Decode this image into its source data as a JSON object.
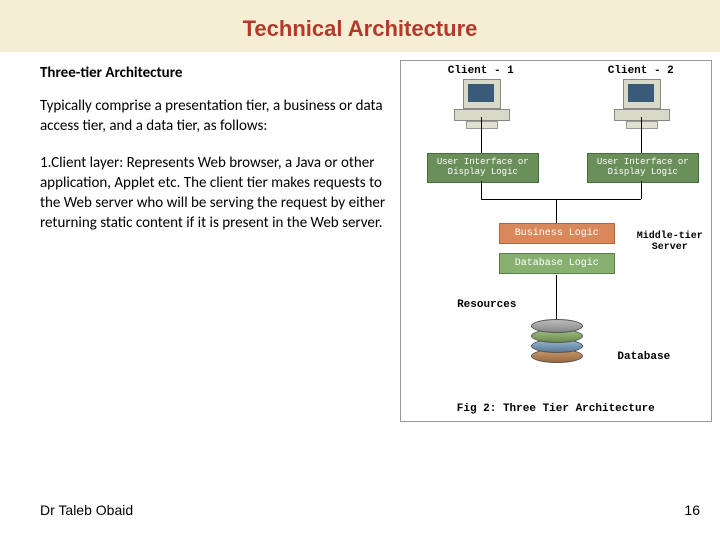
{
  "title": "Technical Architecture",
  "subheading": "Three-tier Architecture",
  "intro": "Typically comprise a presentation tier, a business or data access tier, and a data tier, as follows:",
  "point1": "1.Client layer: Represents Web browser, a Java or other application, Applet etc. The client tier makes requests to the Web server who will be serving the request by either returning static content if it is present in the Web server.",
  "diagram": {
    "client1": "Client - 1",
    "client2": "Client - 2",
    "uiBox": "User Interface or Display Logic",
    "business": "Business Logic",
    "database": "Database Logic",
    "midTier": "Middle-tier Server",
    "resources": "Resources",
    "dbLabel": "Database",
    "caption": "Fig 2: Three Tier Architecture"
  },
  "footer": {
    "author": "Dr Taleb Obaid",
    "page": "16"
  }
}
